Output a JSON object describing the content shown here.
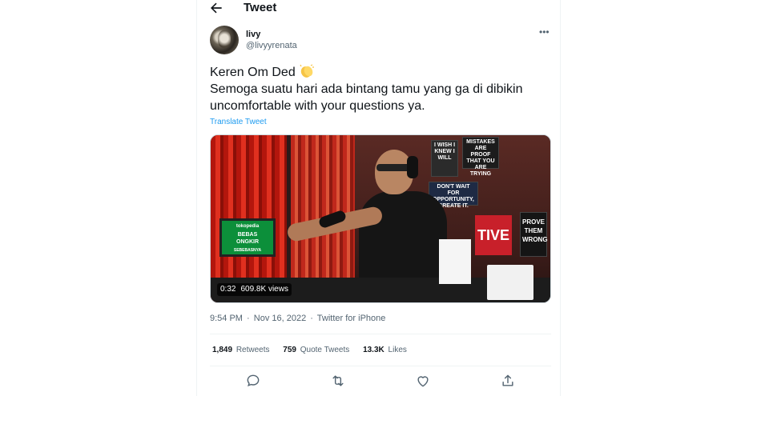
{
  "header": {
    "title": "Tweet"
  },
  "author": {
    "name": "livy",
    "handle": "@livyyrenata"
  },
  "tweet": {
    "lines": [
      "Keren Om Ded",
      "Semoga suatu hari ada bintang tamu yang ga di dibikin",
      "uncomfortable with your questions ya."
    ],
    "emoji": "clapping-hands",
    "translate_label": "Translate Tweet"
  },
  "media": {
    "duration": "0:32",
    "views": "609.8K views",
    "screen_brand": "tokopedia",
    "screen_line1": "BEBAS",
    "screen_line2": "ONGKIR",
    "screen_line3": "SEBEBASNYA",
    "poster1": "I WISH I KNEW I WILL",
    "poster2": "MISTAKES ARE PROOF THAT YOU ARE TRYING",
    "poster3": "DON'T WAIT FOR OPPORTUNITY, CREATE IT.",
    "poster4": "PROVE THEM WRONG",
    "poster5": "TIVE"
  },
  "meta": {
    "time": "9:54 PM",
    "date": "Nov 16, 2022",
    "source": "Twitter for iPhone"
  },
  "stats": {
    "retweets_count": "1,849",
    "retweets_label": "Retweets",
    "quotes_count": "759",
    "quotes_label": "Quote Tweets",
    "likes_count": "13.3K",
    "likes_label": "Likes"
  },
  "colors": {
    "link": "#1d9bf0",
    "secondary_text": "#536471",
    "primary_text": "#0f1419"
  }
}
